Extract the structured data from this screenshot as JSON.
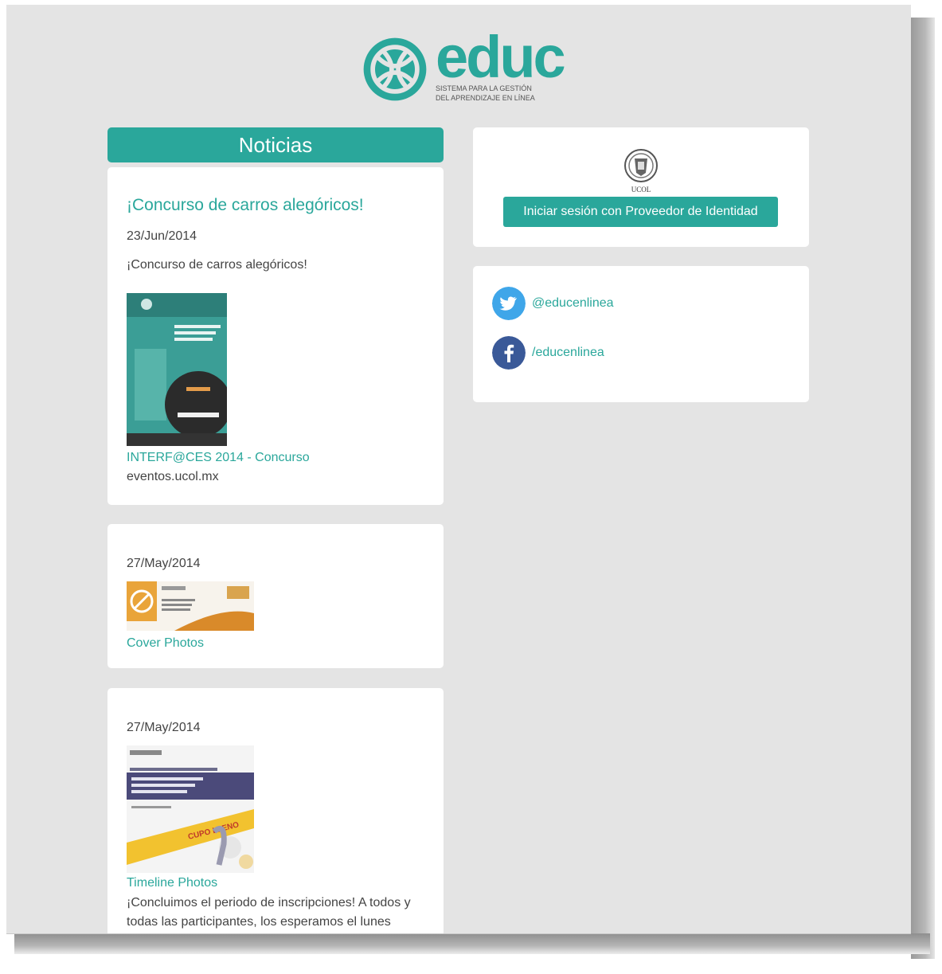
{
  "brand": {
    "name": "educ",
    "tagline_line1": "SISTEMA PARA LA GESTIÓN",
    "tagline_line2": "DEL APRENDIZAJE EN LÍNEA"
  },
  "news": {
    "header": "Noticias",
    "items": [
      {
        "title": "¡Concurso de carros alegóricos!",
        "date": "23/Jun/2014",
        "text": "¡Concurso de carros alegóricos!",
        "link": "INTERF@CES 2014 - Concurso",
        "source": "eventos.ucol.mx"
      },
      {
        "date": "27/May/2014",
        "link": "Cover Photos"
      },
      {
        "date": "27/May/2014",
        "link": "Timeline Photos",
        "body": "¡Concluimos el periodo de inscripciones! A todos y todas las participantes, los esperamos el lunes"
      }
    ]
  },
  "login": {
    "seal_label": "UCOL",
    "button": "Iniciar sesión con Proveedor de Identidad"
  },
  "social": {
    "twitter": "@educenlinea",
    "facebook": "/educenlinea"
  },
  "colors": {
    "accent": "#2aa79b",
    "background": "#e4e4e4",
    "twitter": "#3fa6e9",
    "facebook": "#3a5998"
  }
}
